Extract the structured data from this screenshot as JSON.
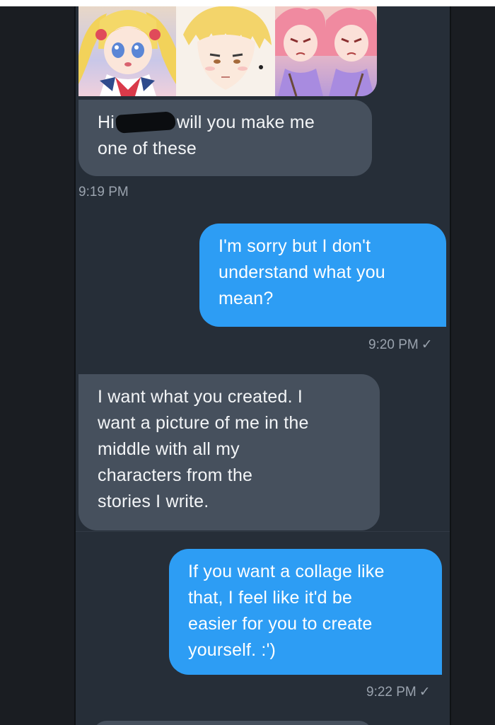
{
  "messages": [
    {
      "id": "m1",
      "direction": "incoming",
      "text_before": "Hi",
      "text_after": "will you make me",
      "text_line2": "one of these",
      "time": "9:19 PM"
    },
    {
      "id": "m2",
      "direction": "outgoing",
      "lines": [
        "I'm sorry but I don't",
        "understand what you",
        "mean?"
      ],
      "time": "9:20 PM",
      "status": "✓"
    },
    {
      "id": "m3",
      "direction": "incoming",
      "lines": [
        "I want what you created. I",
        "want a picture of me in the",
        "middle with all my",
        "characters from the",
        "stories I write."
      ]
    },
    {
      "id": "m4",
      "direction": "outgoing",
      "lines": [
        "If you want a collage like",
        "that, I feel like it'd be",
        "easier for you to create",
        "yourself. :')"
      ],
      "time": "9:22 PM",
      "status": "✓"
    }
  ],
  "colors": {
    "background": "#262e38",
    "incoming_bubble": "#46505d",
    "outgoing_bubble": "#2d9df4",
    "timestamp": "#9aa3ae"
  }
}
